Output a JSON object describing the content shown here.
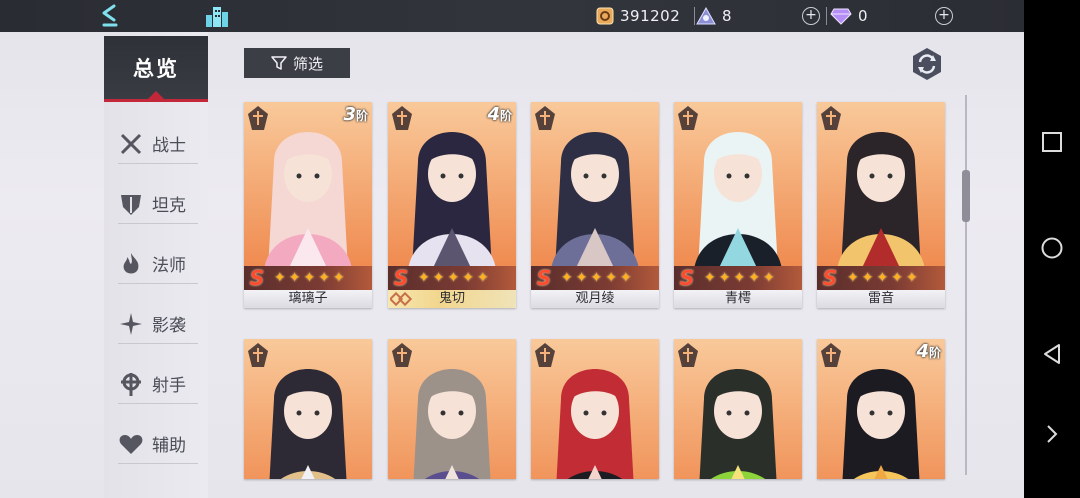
{
  "resources": {
    "gold": "391202",
    "crystal": "8",
    "gem": "0",
    "plus": "+"
  },
  "sidebar": {
    "overview": "总览",
    "items": [
      {
        "label": "战士",
        "icon": "crossed-swords-icon"
      },
      {
        "label": "坦克",
        "icon": "shield-icon"
      },
      {
        "label": "法师",
        "icon": "flame-icon"
      },
      {
        "label": "影袭",
        "icon": "shuriken-icon"
      },
      {
        "label": "射手",
        "icon": "crosshair-icon"
      },
      {
        "label": "辅助",
        "icon": "heart-icon"
      }
    ]
  },
  "toolbar": {
    "filter_label": "筛选"
  },
  "cards": [
    {
      "name": "璃璃子",
      "grade": "S",
      "stars": 5,
      "rank": "3",
      "rank_suffix": "阶",
      "palette": [
        "#f5d7d3",
        "#f3a9c0",
        "#fbe8ef"
      ]
    },
    {
      "name": "鬼切",
      "grade": "S",
      "stars": 5,
      "rank": "4",
      "rank_suffix": "阶",
      "palette": [
        "#2b2740",
        "#e6e2ef",
        "#5b5570"
      ]
    },
    {
      "name": "观月绫",
      "grade": "S",
      "stars": 5,
      "rank": "",
      "rank_suffix": "",
      "palette": [
        "#2e2f44",
        "#6d6f98",
        "#d9c7c5"
      ]
    },
    {
      "name": "青樗",
      "grade": "S",
      "stars": 5,
      "rank": "",
      "rank_suffix": "",
      "palette": [
        "#eaf4f5",
        "#19202a",
        "#93d8e0"
      ]
    },
    {
      "name": "雷音",
      "grade": "S",
      "stars": 5,
      "rank": "",
      "rank_suffix": "",
      "palette": [
        "#2b2428",
        "#f2c46b",
        "#b32c2c"
      ]
    },
    {
      "name": "",
      "grade": "",
      "stars": 0,
      "rank": "",
      "rank_suffix": "",
      "palette": [
        "#2d2a35",
        "#e3c08a",
        "#f1f0f4"
      ]
    },
    {
      "name": "",
      "grade": "",
      "stars": 0,
      "rank": "",
      "rank_suffix": "",
      "palette": [
        "#9d928a",
        "#5a4e8e",
        "#efe3dc"
      ]
    },
    {
      "name": "",
      "grade": "",
      "stars": 0,
      "rank": "",
      "rank_suffix": "",
      "palette": [
        "#c22c34",
        "#1d1c22",
        "#f2d4cc"
      ]
    },
    {
      "name": "",
      "grade": "",
      "stars": 0,
      "rank": "",
      "rank_suffix": "",
      "palette": [
        "#2b2f2a",
        "#8cd43a",
        "#f5e27a"
      ]
    },
    {
      "name": "",
      "grade": "",
      "stars": 0,
      "rank": "4",
      "rank_suffix": "阶",
      "palette": [
        "#1d1b22",
        "#f6c65a",
        "#f0a843"
      ]
    }
  ],
  "colors": {
    "accent_red": "#c3283a",
    "dark_panel": "#3c3e46",
    "card_orange": "#f0955a",
    "star_gold": "#ffb020"
  }
}
